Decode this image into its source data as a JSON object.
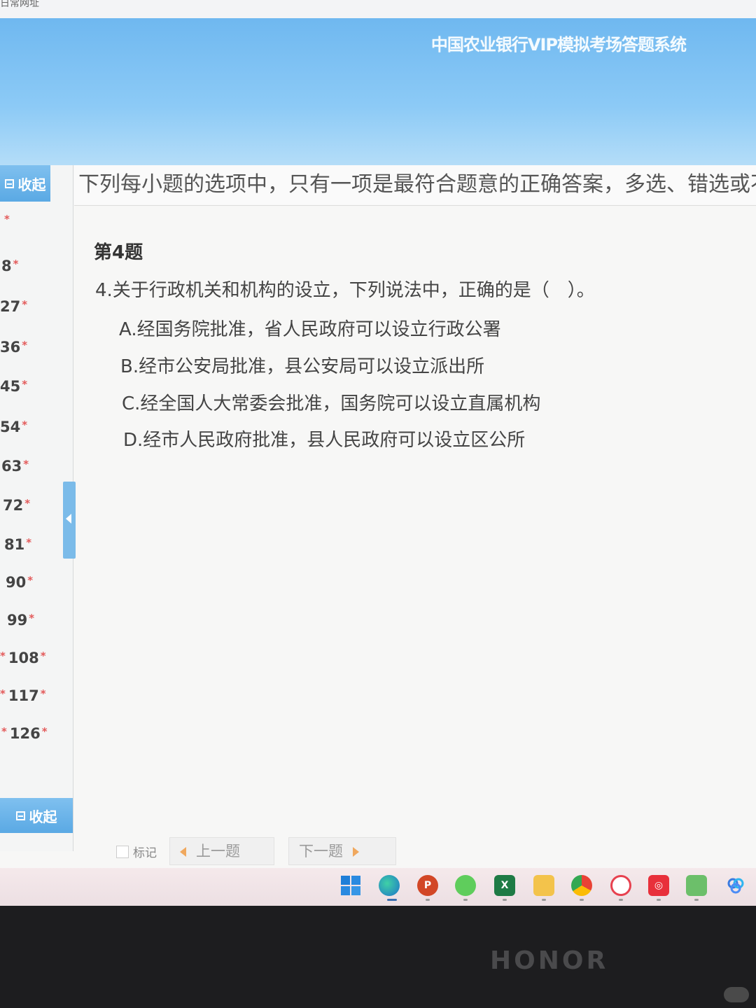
{
  "browser": {
    "url_fragment": "日常网址"
  },
  "header": {
    "title": "中国农业银行VIP模拟考场答题系统"
  },
  "sidebar": {
    "collapse_top_label": "收起",
    "collapse_bottom_label": "收起",
    "items": [
      "8",
      "27",
      "36",
      "45",
      "54",
      "63",
      "72",
      "81",
      "90",
      "99",
      "108",
      "117",
      "126"
    ]
  },
  "instruction": "下列每小题的选项中，只有一项是最符合题意的正确答案，多选、错选或不",
  "question": {
    "heading": "第4题",
    "text": "4.关于行政机关和机构的设立，下列说法中，正确的是（　）。",
    "options": [
      "A.经国务院批准，省人民政府可以设立行政公署",
      "B.经市公安局批准，县公安局可以设立派出所",
      "C.经全国人大常委会批准，国务院可以设立直属机构",
      "D.经市人民政府批准，县人民政府可以设立区公所"
    ]
  },
  "controls": {
    "mark_label": "标记",
    "prev_label": "上一题",
    "next_label": "下一题"
  },
  "taskbar": {
    "icons": [
      "windows-start-icon",
      "edge-browser-icon",
      "powerpoint-icon",
      "wechat-icon",
      "excel-icon",
      "file-explorer-icon",
      "chrome-icon",
      "quark-icon",
      "netease-music-icon",
      "remote-desktop-icon",
      "baidu-netdisk-icon"
    ]
  },
  "device": {
    "brand": "HONOR"
  },
  "colors": {
    "accent": "#5aa9e4",
    "banner": "#8ccaf6",
    "required_star": "#e35a5a",
    "nav_arrow": "#f0a85e"
  }
}
